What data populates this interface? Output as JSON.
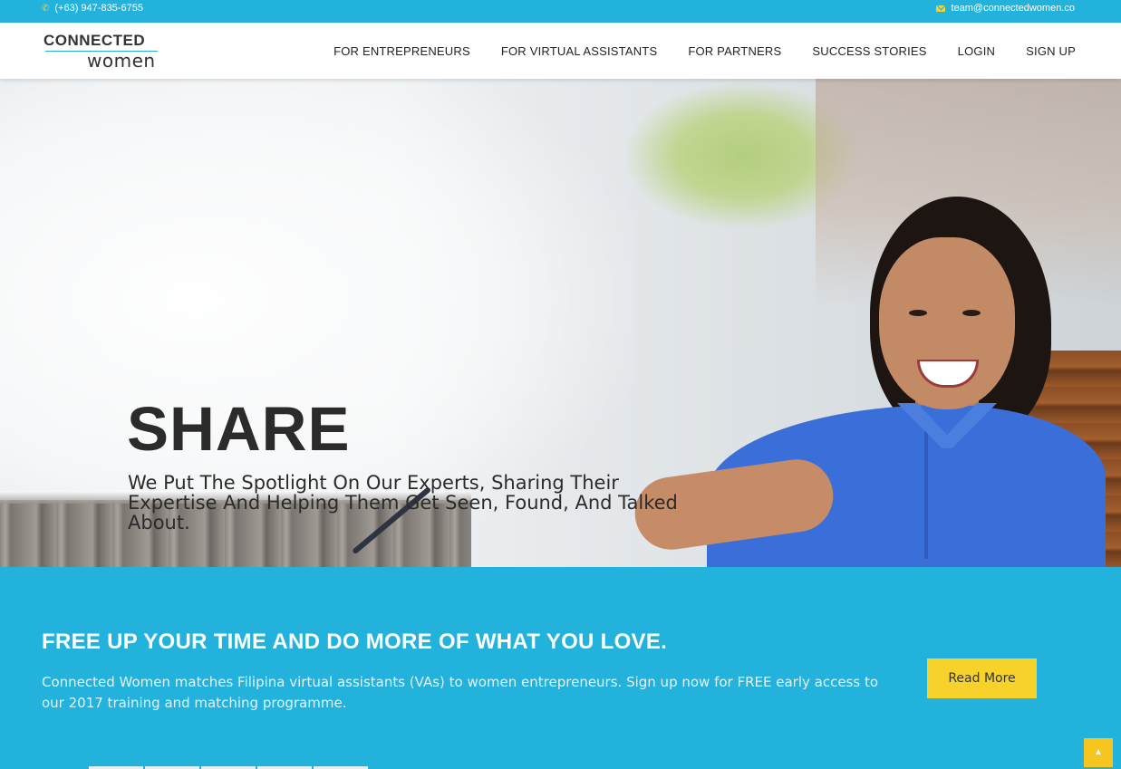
{
  "topbar": {
    "phone": "(+63) 947-835-6755",
    "email": "team@connectedwomen.co",
    "accent_color": "#f7d22b",
    "background_color": "#22b2dc"
  },
  "logo": {
    "line1": "CONNECTED",
    "line2": "women"
  },
  "nav": {
    "items": [
      {
        "label": "FOR ENTREPRENEURS"
      },
      {
        "label": "FOR VIRTUAL ASSISTANTS"
      },
      {
        "label": "FOR PARTNERS"
      },
      {
        "label": "SUCCESS STORIES"
      },
      {
        "label": "LOGIN"
      },
      {
        "label": "SIGN UP"
      }
    ]
  },
  "hero": {
    "title": "SHARE",
    "subtitle": "We Put The Spotlight On Our Experts, Sharing Their Expertise And Helping Them Get Seen, Found, And Talked About."
  },
  "cta": {
    "title": "FREE UP YOUR TIME AND DO MORE OF WHAT YOU LOVE.",
    "text": "Connected Women matches Filipina virtual assistants (VAs) to women entrepreneurs. Sign up now for FREE early access to our 2017 training and matching programme.",
    "button_label": "Read More",
    "button_color": "#f7d22b"
  },
  "icons": {
    "phone": "phone-icon",
    "email": "envelope-icon",
    "scroll_top": "chevron-up-icon"
  }
}
